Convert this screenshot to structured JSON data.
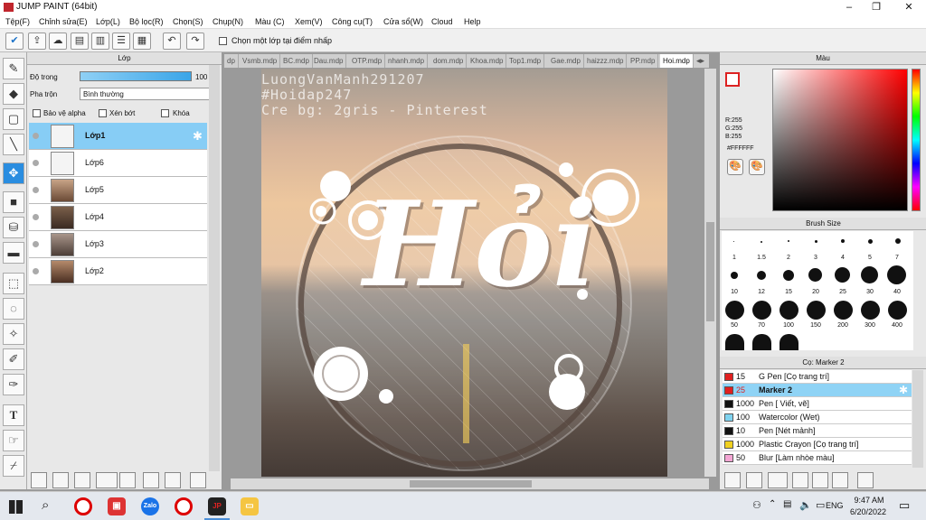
{
  "app": {
    "title": "JUMP PAINT (64bit)"
  },
  "menu": [
    "Tệp(F)",
    "Chỉnh sửa(E)",
    "Lớp(L)",
    "Bộ lọc(R)",
    "Chọn(S)",
    "Chụp(N)",
    "Màu (C)",
    "Xem(V)",
    "Công cụ(T)",
    "Cửa sổ(W)",
    "Cloud",
    "Help"
  ],
  "toolbar": {
    "select_layer_label": "Chọn một lớp tại điểm nhấp"
  },
  "layers": {
    "header": "Lớp",
    "opacity_label": "Độ trong",
    "opacity_value": "100 %",
    "blend_label": "Pha trộn",
    "blend_value": "Bình thường",
    "protect_alpha": "Bảo vệ alpha",
    "clipping": "Xén bớt",
    "lock": "Khóa",
    "items": [
      {
        "name": "Lớp1"
      },
      {
        "name": "Lớp6"
      },
      {
        "name": "Lớp5"
      },
      {
        "name": "Lớp4"
      },
      {
        "name": "Lớp3"
      },
      {
        "name": "Lớp2"
      }
    ]
  },
  "tabs": [
    "dp",
    "Vsmb.mdp",
    "BC.mdp",
    "Dau.mdp",
    "OTP.mdp",
    "nhanh.mdp",
    "dom.mdp",
    "Khoa.mdp",
    "Top1.mdp",
    "Gae.mdp",
    "haizzz.mdp",
    "PP.mdp",
    "Hoi.mdp"
  ],
  "canvas": {
    "watermark": [
      "LuongVanManh291207",
      "#Hoidap247",
      "Cre bg: 2gris - Pinterest"
    ],
    "art_text": "Hỏi"
  },
  "color": {
    "header": "Màu",
    "r": "R:255",
    "g": "G:255",
    "b": "B:255",
    "hex": "#FFFFFF"
  },
  "brush_size": {
    "header": "Brush Size",
    "sizes": [
      "1",
      "1.5",
      "2",
      "3",
      "4",
      "5",
      "7",
      "10",
      "12",
      "15",
      "20",
      "25",
      "30",
      "40",
      "50",
      "70",
      "100",
      "150",
      "200",
      "300",
      "400"
    ]
  },
  "brushes": {
    "header": "Cọ: Marker 2",
    "items": [
      {
        "size": "15",
        "name": "G Pen [Cọ trang trí]",
        "color": "#e02020"
      },
      {
        "size": "25",
        "name": "Marker 2",
        "color": "#e02020"
      },
      {
        "size": "1000",
        "name": "Pen [ Viết, vẽ]",
        "color": "#111111"
      },
      {
        "size": "100",
        "name": "Watercolor (Wet)",
        "color": "#7fd3f0"
      },
      {
        "size": "10",
        "name": "Pen [Nét mảnh]",
        "color": "#111111"
      },
      {
        "size": "1000",
        "name": "Plastic Crayon [Cọ trang trí]",
        "color": "#f0d020"
      },
      {
        "size": "50",
        "name": "Blur [Làm nhòe màu]",
        "color": "#f4a6d4"
      }
    ]
  },
  "taskbar": {
    "time": "9:47 AM",
    "date": "6/20/2022",
    "lang": "ENG"
  }
}
